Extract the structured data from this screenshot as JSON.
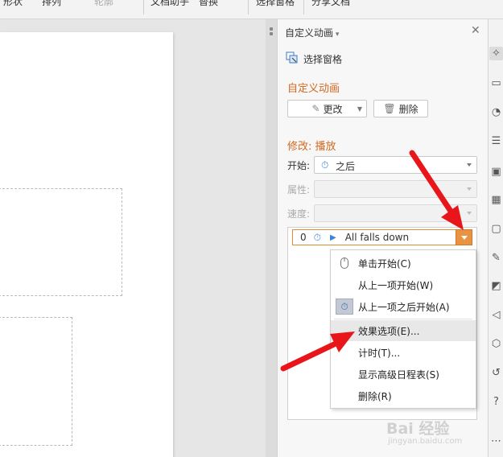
{
  "toolbar": {
    "items": [
      "形状",
      "排列",
      "轮廓",
      "文档助手",
      "替换",
      "选择窗格",
      "分享文档"
    ]
  },
  "pane": {
    "title": "自定义动画",
    "selection_pane_label": "选择窗格",
    "section_title": "自定义动画",
    "change_button": "更改",
    "delete_button": "删除",
    "modify_title": "修改: 播放",
    "start_label": "开始:",
    "start_value": "之后",
    "property_label": "属性:",
    "speed_label": "速度:"
  },
  "animation_list": [
    {
      "order": "0",
      "effect": "All falls down"
    }
  ],
  "context_menu": {
    "items": [
      {
        "label": "单击开始(C)",
        "icon": "mouse-icon"
      },
      {
        "label": "从上一项开始(W)",
        "icon": ""
      },
      {
        "label": "从上一项之后开始(A)",
        "icon": "clock-icon"
      },
      {
        "label": "效果选项(E)...",
        "icon": ""
      },
      {
        "label": "计时(T)...",
        "icon": ""
      },
      {
        "label": "显示高级日程表(S)",
        "icon": ""
      },
      {
        "label": "删除(R)",
        "icon": ""
      }
    ],
    "highlighted_index": 3
  },
  "watermark": {
    "text": "Bai 经验",
    "url": "jingyan.baidu.com"
  },
  "colors": {
    "accent_orange": "#e9923f",
    "section_title": "#d2691e",
    "arrow_red": "#e8161a"
  }
}
